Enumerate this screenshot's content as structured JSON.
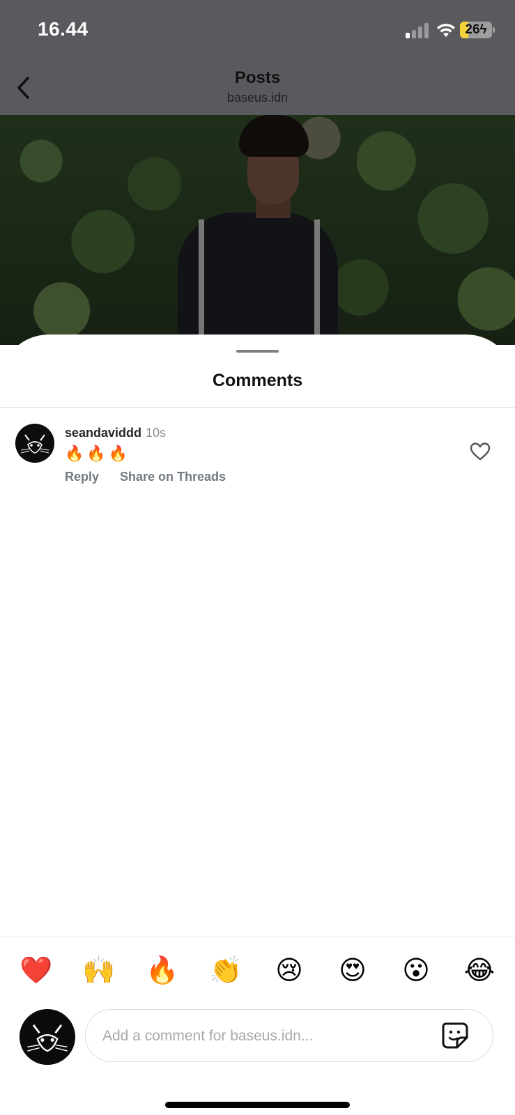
{
  "status_bar": {
    "time": "16.44",
    "battery_level": "26",
    "battery_fill_percent": 26,
    "signal_bars_active": 1,
    "signal_bars_total": 4
  },
  "header": {
    "title": "Posts",
    "subtitle": "baseus.idn",
    "back_icon": "chevron-left-icon"
  },
  "sheet": {
    "title": "Comments"
  },
  "comments": [
    {
      "username": "seandaviddd",
      "time": "10s",
      "text": "🔥🔥🔥",
      "reply_label": "Reply",
      "share_label": "Share on Threads",
      "like_icon": "heart-outline-icon"
    }
  ],
  "reactions": [
    "❤️",
    "🙌",
    "🔥",
    "👏",
    "😢",
    "😍",
    "😮",
    "😂"
  ],
  "composer": {
    "placeholder": "Add a comment for baseus.idn...",
    "sticker_icon": "sticker-icon"
  },
  "colors": {
    "dim_overlay": "#595a5e",
    "battery_accent": "#f5d33b",
    "secondary_text": "#737a82"
  }
}
